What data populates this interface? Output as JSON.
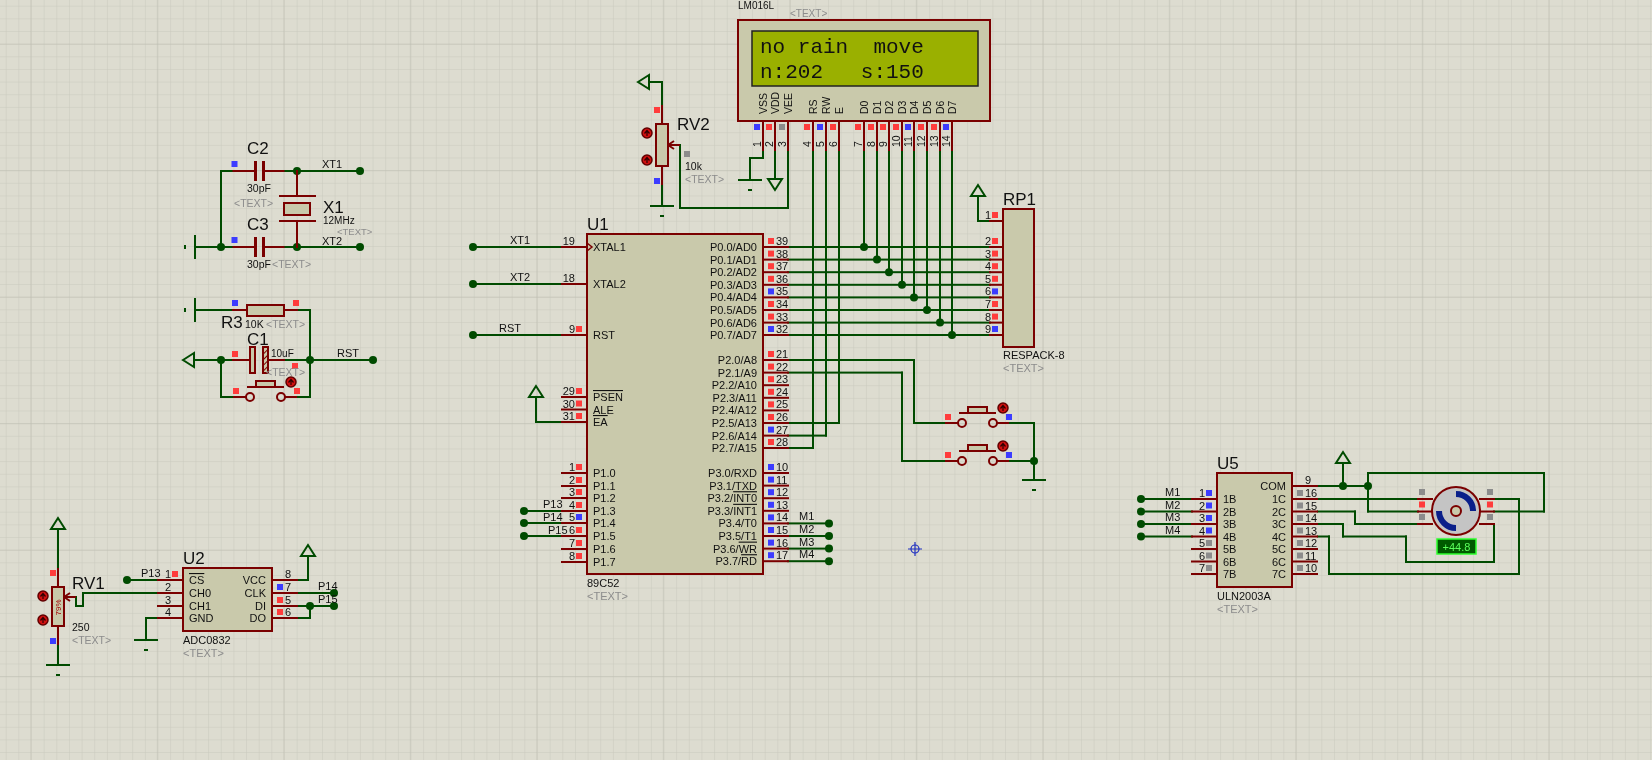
{
  "components": [
    {
      "kind": "lcd",
      "part_name": "LM016L",
      "text_tag": "<TEXT>",
      "display_lines": [
        "no rain  move",
        "n:202   s:150"
      ],
      "pins": [
        {
          "number": "1",
          "name": "VSS",
          "color": "#3c3cff"
        },
        {
          "number": "2",
          "name": "VDD",
          "color": "#ff3c3c"
        },
        {
          "number": "3",
          "name": "VEE",
          "color": "#8c8c8c"
        },
        {
          "number": "4",
          "name": "RS",
          "color": "#ff3c3c"
        },
        {
          "number": "5",
          "name": "RW",
          "color": "#3c3cff"
        },
        {
          "number": "6",
          "name": "E",
          "color": "#ff3c3c"
        },
        {
          "number": "7",
          "name": "D0",
          "color": "#ff3c3c"
        },
        {
          "number": "8",
          "name": "D1",
          "color": "#ff3c3c"
        },
        {
          "number": "9",
          "name": "D2",
          "color": "#ff3c3c"
        },
        {
          "number": "10",
          "name": "D3",
          "color": "#ff3c3c"
        },
        {
          "number": "11",
          "name": "D4",
          "color": "#3c3cff"
        },
        {
          "number": "12",
          "name": "D5",
          "color": "#ff3c3c"
        },
        {
          "number": "13",
          "name": "D6",
          "color": "#ff3c3c"
        },
        {
          "number": "14",
          "name": "D7",
          "color": "#3c3cff"
        }
      ]
    },
    {
      "kind": "pot",
      "ref": "RV2",
      "value": "10k",
      "text_tag": "<TEXT>",
      "terminals": [
        {
          "kind": "top",
          "color": "#ff3c3c"
        },
        {
          "kind": "wiper",
          "color": "#8c8c8c"
        },
        {
          "kind": "bottom",
          "color": "#3c3cff"
        }
      ]
    },
    {
      "kind": "capacitor",
      "ref": "C2",
      "value": "30pF",
      "text_tag": "<TEXT>",
      "terminals": [
        {
          "kind": "left",
          "color": "#3c3cff"
        }
      ]
    },
    {
      "kind": "crystal",
      "ref": "X1",
      "value": "12MHz",
      "text_tag": "<TEXT>"
    },
    {
      "kind": "capacitor",
      "ref": "C3",
      "value": "30pF",
      "text_tag": "<TEXT>",
      "terminals": [
        {
          "kind": "left",
          "color": "#3c3cff"
        }
      ]
    },
    {
      "kind": "resistor",
      "ref": "R3",
      "value": "10K",
      "text_tag": "<TEXT>",
      "terminals": [
        {
          "kind": "left",
          "color": "#3c3cff"
        },
        {
          "kind": "right",
          "color": "#ff3c3c"
        }
      ]
    },
    {
      "kind": "electrolytic",
      "ref": "C1",
      "value": "10uF",
      "text_tag": "<TEXT>",
      "terminals": [
        {
          "kind": "left",
          "color": "#ff3c3c"
        },
        {
          "kind": "right",
          "color": "#ff3c3c"
        }
      ]
    },
    {
      "kind": "button",
      "terminals": [
        {
          "kind": "left",
          "color": "#ff3c3c"
        },
        {
          "kind": "right",
          "color": "#ff3c3c"
        }
      ]
    },
    {
      "kind": "mcu",
      "ref": "U1",
      "part_name": "89C52",
      "text_tag": "<TEXT>",
      "left_pins": [
        {
          "number": "19",
          "name": "XTAL1"
        },
        {
          "number": "18",
          "name": "XTAL2"
        },
        {
          "number": "9",
          "name": "RST",
          "color": "#ff3c3c"
        },
        {
          "number": "29",
          "bar_name": "PSEN",
          "color": "#ff3c3c"
        },
        {
          "number": "30",
          "name": "ALE",
          "color": "#ff3c3c"
        },
        {
          "number": "31",
          "bar_name": "EA",
          "color": "#ff3c3c"
        },
        {
          "number": "1",
          "name": "P1.0",
          "color": "#ff3c3c"
        },
        {
          "number": "2",
          "name": "P1.1",
          "color": "#ff3c3c"
        },
        {
          "number": "3",
          "name": "P1.2",
          "color": "#ff3c3c"
        },
        {
          "number": "4",
          "name": "P1.3",
          "color": "#ff3c3c"
        },
        {
          "number": "5",
          "name": "P1.4",
          "color": "#3c3cff"
        },
        {
          "number": "6",
          "name": "P1.5",
          "color": "#ff3c3c"
        },
        {
          "number": "7",
          "name": "P1.6",
          "color": "#ff3c3c"
        },
        {
          "number": "8",
          "name": "P1.7",
          "color": "#ff3c3c"
        }
      ],
      "right_pins": [
        {
          "number": "39",
          "name": "P0.0/AD0",
          "color": "#ff3c3c"
        },
        {
          "number": "38",
          "name": "P0.1/AD1",
          "color": "#ff3c3c"
        },
        {
          "number": "37",
          "name": "P0.2/AD2",
          "color": "#ff3c3c"
        },
        {
          "number": "36",
          "name": "P0.3/AD3",
          "color": "#ff3c3c"
        },
        {
          "number": "35",
          "name": "P0.4/AD4",
          "color": "#3c3cff"
        },
        {
          "number": "34",
          "name": "P0.5/AD5",
          "color": "#ff3c3c"
        },
        {
          "number": "33",
          "name": "P0.6/AD6",
          "color": "#ff3c3c"
        },
        {
          "number": "32",
          "name": "P0.7/AD7",
          "color": "#3c3cff"
        },
        {
          "number": "21",
          "name": "P2.0/A8",
          "color": "#ff3c3c"
        },
        {
          "number": "22",
          "name": "P2.1/A9",
          "color": "#ff3c3c"
        },
        {
          "number": "23",
          "name": "P2.2/A10",
          "color": "#ff3c3c"
        },
        {
          "number": "24",
          "name": "P2.3/A11",
          "color": "#ff3c3c"
        },
        {
          "number": "25",
          "name": "P2.4/A12",
          "color": "#ff3c3c"
        },
        {
          "number": "26",
          "name": "P2.5/A13",
          "color": "#ff3c3c"
        },
        {
          "number": "27",
          "name": "P2.6/A14",
          "color": "#3c3cff"
        },
        {
          "number": "28",
          "name": "P2.7/A15",
          "color": "#ff3c3c"
        },
        {
          "number": "10",
          "name": "P3.0/RXD",
          "color": "#3c3cff"
        },
        {
          "number": "11",
          "name": "P3.1/TXD",
          "color": "#3c3cff"
        },
        {
          "number": "12",
          "name": "P3.2/",
          "bar_name": "INT0",
          "color": "#3c3cff"
        },
        {
          "number": "13",
          "name": "P3.3/",
          "bar_name": "INT1",
          "color": "#3c3cff"
        },
        {
          "number": "14",
          "name": "P3.4/T0",
          "color": "#3c3cff"
        },
        {
          "number": "15",
          "name": "P3.5/T1",
          "color": "#3c3cff"
        },
        {
          "number": "16",
          "name": "P3.6/",
          "bar_name": "WR",
          "color": "#3c3cff"
        },
        {
          "number": "17",
          "name": "P3.7/",
          "bar_name": "RD",
          "color": "#3c3cff"
        }
      ]
    },
    {
      "kind": "resnet",
      "ref": "RP1",
      "part_name": "RESPACK-8",
      "text_tag": "<TEXT>",
      "left_pins": [
        {
          "number": "1",
          "color": "#ff3c3c"
        },
        {
          "number": "2",
          "color": "#ff3c3c"
        },
        {
          "number": "3",
          "color": "#ff3c3c"
        },
        {
          "number": "4",
          "color": "#ff3c3c"
        },
        {
          "number": "5",
          "color": "#ff3c3c"
        },
        {
          "number": "6",
          "color": "#3c3cff"
        },
        {
          "number": "7",
          "color": "#ff3c3c"
        },
        {
          "number": "8",
          "color": "#ff3c3c"
        },
        {
          "number": "9",
          "color": "#3c3cff"
        }
      ]
    },
    {
      "kind": "button",
      "terminals": [
        {
          "kind": "left",
          "color": "#ff3c3c"
        },
        {
          "kind": "right",
          "color": "#3c3cff"
        }
      ]
    },
    {
      "kind": "button",
      "terminals": [
        {
          "kind": "left",
          "color": "#ff3c3c"
        },
        {
          "kind": "right",
          "color": "#3c3cff"
        }
      ]
    },
    {
      "kind": "driver",
      "ref": "U5",
      "part_name": "ULN2003A",
      "text_tag": "<TEXT>",
      "left_pins": [
        {
          "number": "1",
          "name": "1B",
          "color": "#3c3cff"
        },
        {
          "number": "2",
          "name": "2B",
          "color": "#3c3cff"
        },
        {
          "number": "3",
          "name": "3B",
          "color": "#3c3cff"
        },
        {
          "number": "4",
          "name": "4B",
          "color": "#3c3cff"
        },
        {
          "number": "5",
          "name": "5B",
          "color": "#8c8c8c"
        },
        {
          "number": "6",
          "name": "6B",
          "color": "#8c8c8c"
        },
        {
          "number": "7",
          "name": "7B",
          "color": "#8c8c8c"
        }
      ],
      "right_pins": [
        {
          "number": "9",
          "name": "COM"
        },
        {
          "number": "16",
          "name": "1C",
          "color": "#8c8c8c"
        },
        {
          "number": "15",
          "name": "2C",
          "color": "#8c8c8c"
        },
        {
          "number": "14",
          "name": "3C",
          "color": "#8c8c8c"
        },
        {
          "number": "13",
          "name": "4C",
          "color": "#8c8c8c"
        },
        {
          "number": "12",
          "name": "5C",
          "color": "#8c8c8c"
        },
        {
          "number": "11",
          "name": "6C",
          "color": "#8c8c8c"
        },
        {
          "number": "10",
          "name": "7C",
          "color": "#8c8c8c"
        }
      ]
    },
    {
      "kind": "motor",
      "reading": "+44.8",
      "terminals": [
        {
          "kind": "left",
          "color": "#8c8c8c"
        },
        {
          "kind": "left",
          "color": "#ff3c3c"
        },
        {
          "kind": "left",
          "color": "#8c8c8c"
        },
        {
          "kind": "right",
          "color": "#8c8c8c"
        },
        {
          "kind": "right",
          "color": "#ff3c3c"
        },
        {
          "kind": "right",
          "color": "#8c8c8c"
        }
      ]
    },
    {
      "kind": "pot",
      "ref": "RV1",
      "value": "250",
      "text_tag": "<TEXT>",
      "wiper_text": "79%",
      "terminals": [
        {
          "kind": "top",
          "color": "#ff3c3c"
        },
        {
          "kind": "bottom",
          "color": "#3c3cff"
        }
      ]
    },
    {
      "kind": "adc",
      "ref": "U2",
      "part_name": "ADC0832",
      "text_tag": "<TEXT>",
      "left_pins": [
        {
          "number": "1",
          "bar_name": "CS",
          "color": "#ff3c3c"
        },
        {
          "number": "2",
          "name": "CH0"
        },
        {
          "number": "3",
          "name": "CH1"
        },
        {
          "number": "4",
          "name": "GND"
        }
      ],
      "right_pins": [
        {
          "number": "8",
          "name": "VCC"
        },
        {
          "number": "7",
          "name": "CLK",
          "color": "#3c3cff"
        },
        {
          "number": "5",
          "name": "DI",
          "color": "#ff3c3c"
        },
        {
          "number": "6",
          "name": "DO",
          "color": "#ff3c3c"
        }
      ]
    }
  ],
  "net_labels": [
    {
      "text": "XT1"
    },
    {
      "text": "XT2"
    },
    {
      "text": "RST"
    },
    {
      "text": "XT1"
    },
    {
      "text": "XT2"
    },
    {
      "text": "RST"
    },
    {
      "text": "P13"
    },
    {
      "text": "P14"
    },
    {
      "text": "P15"
    },
    {
      "text": "M1"
    },
    {
      "text": "M2"
    },
    {
      "text": "M3"
    },
    {
      "text": "M4"
    },
    {
      "text": "P13"
    },
    {
      "text": "P14"
    },
    {
      "text": "P15"
    },
    {
      "text": "M1"
    },
    {
      "text": "M2"
    },
    {
      "text": "M3"
    },
    {
      "text": "M4"
    }
  ]
}
